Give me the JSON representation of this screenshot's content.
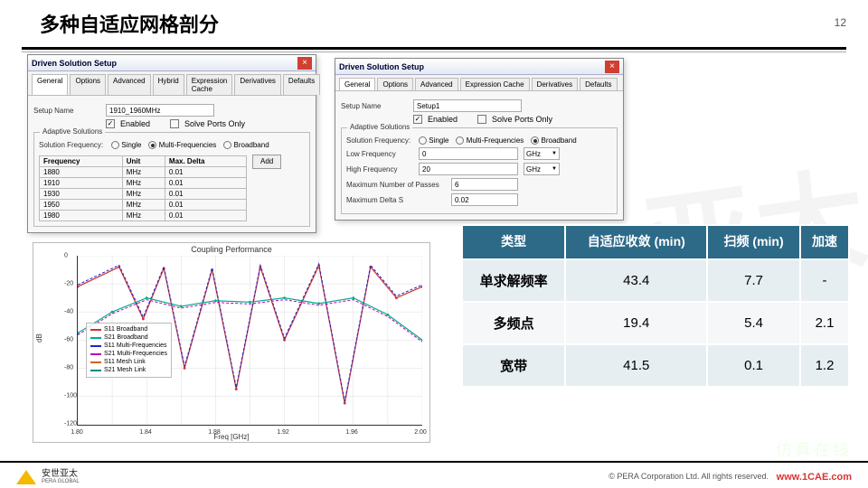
{
  "page": {
    "number": "12",
    "title": "多种自适应网格剖分"
  },
  "dialog1": {
    "title": "Driven Solution Setup",
    "tabs": [
      "General",
      "Options",
      "Advanced",
      "Hybrid",
      "Expression Cache",
      "Derivatives",
      "Defaults"
    ],
    "setupNameLbl": "Setup Name",
    "setupName": "1910_1960MHz",
    "enabledLbl": "Enabled",
    "portsOnlyLbl": "Solve Ports Only",
    "adaptiveLbl": "Adaptive Solutions",
    "solFreqLbl": "Solution Frequency:",
    "radios": [
      "Single",
      "Multi-Frequencies",
      "Broadband"
    ],
    "radioSel": 1,
    "cols": [
      "Frequency",
      "Unit",
      "Max. Delta"
    ],
    "rows": [
      [
        "1880",
        "MHz",
        "0.01"
      ],
      [
        "1910",
        "MHz",
        "0.01"
      ],
      [
        "1930",
        "MHz",
        "0.01"
      ],
      [
        "1950",
        "MHz",
        "0.01"
      ],
      [
        "1980",
        "MHz",
        "0.01"
      ]
    ],
    "addBtn": "Add"
  },
  "dialog2": {
    "title": "Driven Solution Setup",
    "tabs": [
      "General",
      "Options",
      "Advanced",
      "Expression Cache",
      "Derivatives",
      "Defaults"
    ],
    "setupNameLbl": "Setup Name",
    "setupName": "Setup1",
    "enabledLbl": "Enabled",
    "portsOnlyLbl": "Solve Ports Only",
    "adaptiveLbl": "Adaptive Solutions",
    "solFreqLbl": "Solution Frequency:",
    "radios": [
      "Single",
      "Multi-Frequencies",
      "Broadband"
    ],
    "radioSel": 2,
    "lowLbl": "Low Frequency",
    "lowVal": "0",
    "lowUnit": "GHz",
    "highLbl": "High Frequency",
    "highVal": "20",
    "highUnit": "GHz",
    "passesLbl": "Maximum Number of Passes",
    "passesVal": "6",
    "deltaLbl": "Maximum Delta S",
    "deltaVal": "0.02"
  },
  "chart_data": {
    "type": "line",
    "title": "Coupling Performance",
    "xlabel": "Freq [GHz]",
    "ylabel": "dB",
    "xlim": [
      1.8,
      2.0
    ],
    "ylim": [
      -120,
      0
    ],
    "legend": [
      "S11 Broadband",
      "S21 Broadband",
      "S11 Multi-Frequencies",
      "S21 Multi-Frequencies",
      "S11 Mesh Link",
      "S21 Mesh Link"
    ],
    "colors": [
      "#c33",
      "#0a8",
      "#22c",
      "#b0b",
      "#c60",
      "#088"
    ],
    "xticks": [
      1.8,
      1.82,
      1.84,
      1.86,
      1.88,
      1.9,
      1.92,
      1.94,
      1.96,
      1.98,
      2.0
    ],
    "yticks": [
      0,
      -20,
      -40,
      -60,
      -80,
      -100,
      -120
    ],
    "series": [
      {
        "name": "S11",
        "d": [
          [
            1.8,
            -22
          ],
          [
            1.824,
            -8
          ],
          [
            1.838,
            -45
          ],
          [
            1.85,
            -9
          ],
          [
            1.862,
            -80
          ],
          [
            1.878,
            -10
          ],
          [
            1.892,
            -95
          ],
          [
            1.906,
            -8
          ],
          [
            1.92,
            -60
          ],
          [
            1.94,
            -7
          ],
          [
            1.955,
            -105
          ],
          [
            1.97,
            -8
          ],
          [
            1.985,
            -30
          ],
          [
            2.0,
            -22
          ]
        ]
      },
      {
        "name": "S21",
        "d": [
          [
            1.8,
            -55
          ],
          [
            1.82,
            -40
          ],
          [
            1.84,
            -30
          ],
          [
            1.86,
            -36
          ],
          [
            1.88,
            -32
          ],
          [
            1.9,
            -33
          ],
          [
            1.92,
            -30
          ],
          [
            1.94,
            -34
          ],
          [
            1.96,
            -30
          ],
          [
            1.98,
            -42
          ],
          [
            2.0,
            -60
          ]
        ]
      }
    ]
  },
  "results": {
    "headers": [
      "类型",
      "自适应收敛 (min)",
      "扫频 (min)",
      "加速"
    ],
    "rows": [
      [
        "单求解频率",
        "43.4",
        "7.7",
        "-"
      ],
      [
        "多频点",
        "19.4",
        "5.4",
        "2.1"
      ],
      [
        "宽带",
        "41.5",
        "0.1",
        "1.2"
      ]
    ]
  },
  "footer": {
    "brand_cn": "安世亚太",
    "brand_en": "PERA GLOBAL",
    "copy": "© PERA Corporation Ltd. All rights reserved.",
    "wm": "仿真在线",
    "url": "www.1CAE.com"
  }
}
